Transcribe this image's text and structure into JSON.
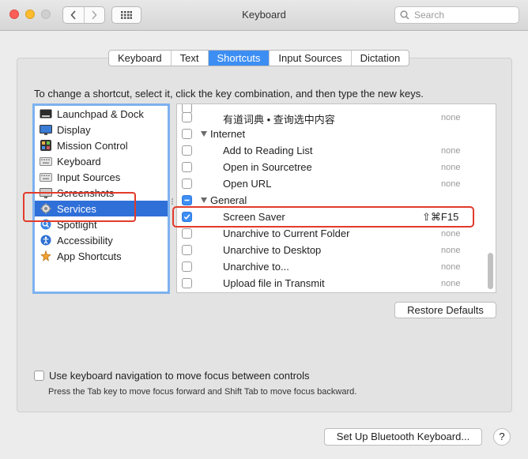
{
  "window": {
    "title": "Keyboard"
  },
  "toolbar": {
    "search_placeholder": "Search"
  },
  "tabs": [
    {
      "label": "Keyboard",
      "active": false
    },
    {
      "label": "Text",
      "active": false
    },
    {
      "label": "Shortcuts",
      "active": true
    },
    {
      "label": "Input Sources",
      "active": false
    },
    {
      "label": "Dictation",
      "active": false
    }
  ],
  "instructions": "To change a shortcut, select it, click the key combination, and then type the new keys.",
  "categories": [
    {
      "label": "Launchpad & Dock",
      "icon": "launchpad-dock-icon"
    },
    {
      "label": "Display",
      "icon": "display-icon"
    },
    {
      "label": "Mission Control",
      "icon": "mission-control-icon"
    },
    {
      "label": "Keyboard",
      "icon": "keyboard-icon"
    },
    {
      "label": "Input Sources",
      "icon": "input-sources-icon"
    },
    {
      "label": "Screenshots",
      "icon": "screenshots-icon"
    },
    {
      "label": "Services",
      "icon": "gear-icon",
      "selected": true
    },
    {
      "label": "Spotlight",
      "icon": "spotlight-icon"
    },
    {
      "label": "Accessibility",
      "icon": "accessibility-icon"
    },
    {
      "label": "App Shortcuts",
      "icon": "app-shortcuts-icon"
    }
  ],
  "shortcuts": {
    "item_0": {
      "name": "有道词典 • 查询选中内容",
      "key": "none"
    },
    "group_internet": "Internet",
    "item_1": {
      "name": "Add to Reading List",
      "key": "none"
    },
    "item_2": {
      "name": "Open in Sourcetree",
      "key": "none"
    },
    "item_3": {
      "name": "Open URL",
      "key": "none"
    },
    "group_general": "General",
    "item_4": {
      "name": "Screen Saver",
      "key": "⇧⌘F15",
      "checked": true
    },
    "item_5": {
      "name": "Unarchive to Current Folder",
      "key": "none"
    },
    "item_6": {
      "name": "Unarchive to Desktop",
      "key": "none"
    },
    "item_7": {
      "name": "Unarchive to...",
      "key": "none"
    },
    "item_8": {
      "name": "Upload file in Transmit",
      "key": "none"
    }
  },
  "buttons": {
    "restore_defaults": "Restore Defaults",
    "bluetooth": "Set Up Bluetooth Keyboard...",
    "help": "?"
  },
  "keyboard_navigation": {
    "label": "Use keyboard navigation to move focus between controls",
    "hint": "Press the Tab key to move focus forward and Shift Tab to move focus backward.",
    "checked": false
  },
  "colors": {
    "accent": "#3d8ef3",
    "selection": "#2f6fd8",
    "highlight": "#e23b2b"
  }
}
